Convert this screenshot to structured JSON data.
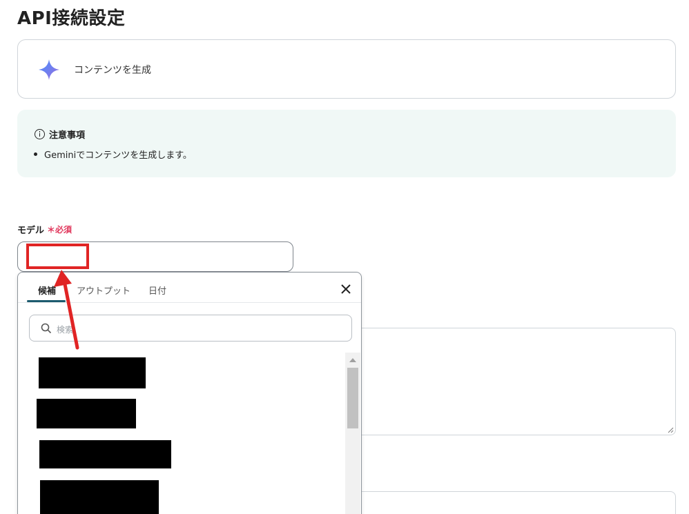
{
  "page": {
    "title": "API接続設定"
  },
  "action": {
    "label": "コンテンツを生成",
    "icon": "gemini-star-icon"
  },
  "notice": {
    "heading": "注意事項",
    "icon": "info-icon",
    "bullets": [
      "Geminiでコンテンツを生成します。"
    ]
  },
  "model_field": {
    "label": "モデル",
    "required_mark": "＊",
    "required_text": "必須",
    "value": ""
  },
  "dropdown": {
    "tabs": [
      {
        "label": "候補",
        "active": true
      },
      {
        "label": "アウトプット",
        "active": false
      },
      {
        "label": "日付",
        "active": false
      }
    ],
    "search_placeholder": "検索",
    "items_redacted_count": 4
  },
  "colors": {
    "accent": "#1c5b6e",
    "required": "#e0365b",
    "annotation_red": "#e02424",
    "notice_bg": "#f0f8f6"
  }
}
